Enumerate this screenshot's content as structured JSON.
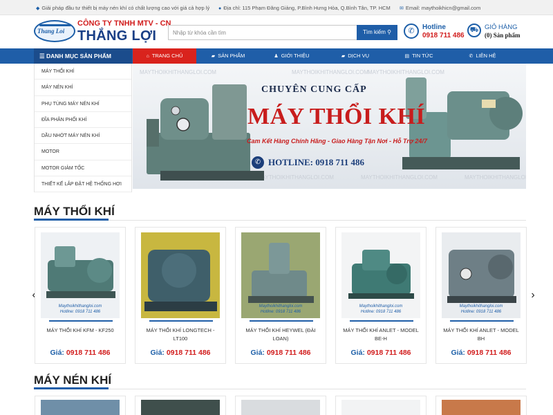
{
  "topbar": {
    "slogan": "Giải pháp đầu tư thiết bị máy nén khí có chất lượng cao với giá cả hợp lý",
    "address": "Địa chỉ: 115 Phạm Đăng Giảng, P.Bình Hưng Hòa, Q.Bình Tân, TP. HCM",
    "email": "Email: maythoikhicn@gmail.com"
  },
  "header": {
    "logo_text": "Thang Loi",
    "company_line1": "CÔNG TY TNHH MTV - CN",
    "company_line2": "THẮNG LỢI",
    "search_placeholder": "Nhập từ khóa cần tìm",
    "search_button": "Tìm kiếm",
    "hotline_label": "Hotline",
    "hotline_number": "0918 711 486",
    "cart_label": "GIỎ HÀNG",
    "cart_count": "(0) Sản phẩm"
  },
  "nav": {
    "category_title": "DANH MỤC SẢN PHẨM",
    "items": [
      "TRANG CHỦ",
      "SẢN PHẨM",
      "GIỚI THIỆU",
      "DỊCH VỤ",
      "TIN TỨC",
      "LIÊN HỆ"
    ]
  },
  "sidebar": {
    "items": [
      "MÁY THỔI KHÍ",
      "MÁY NÉN KHÍ",
      "PHỤ TÙNG MÁY NÉN KHÍ",
      "ĐĨA PHÂN PHỐI KHÍ",
      "DẦU NHỚT MÁY NÉN KHÍ",
      "MOTOR",
      "MOTOR GIẢM TỐC",
      "THIẾT KẾ LẮP ĐẶT HỆ THỐNG HƠI"
    ]
  },
  "banner": {
    "watermark": "MAYTHOIKHITHANGLOI.COM",
    "supply": "CHUYÊN CUNG CẤP",
    "title": "MÁY THỔI KHÍ",
    "tagline": "Cam Kết Hàng Chính Hãng - Giao Hàng Tận Nơi - Hỗ Trợ 24/7",
    "hotline": "HOTLINE: 0918 711 486"
  },
  "section1": {
    "title": "MÁY THỔI KHÍ",
    "products": [
      {
        "name": "MÁY THỔI KHÍ KFM - KF250",
        "price_label": "Giá:",
        "price": "0918 711 486",
        "image_caption": "Maythoikhithangloi.com",
        "image_phone": "Hotline: 0918 711 486"
      },
      {
        "name": "MÁY THỔI KHÍ LONGTECH - LT100",
        "price_label": "Giá:",
        "price": "0918 711 486",
        "image_caption": "",
        "image_phone": ""
      },
      {
        "name": "MÁY THỔI KHÍ HEYWEL (ĐÀI LOAN)",
        "price_label": "Giá:",
        "price": "0918 711 486",
        "image_caption": "Maythoikhithangloi.com",
        "image_phone": "Hotline: 0918 711 486"
      },
      {
        "name": "MÁY THỔI KHÍ ANLET - MODEL BE-H",
        "price_label": "Giá:",
        "price": "0918 711 486",
        "image_caption": "Maythoikhithangloi.com",
        "image_phone": "Hotline: 0918 711 486"
      },
      {
        "name": "MÁY THỔI KHÍ ANLET - MODEL BH",
        "price_label": "Giá:",
        "price": "0918 711 486",
        "image_caption": "Maythoikhithangloi.com",
        "image_phone": "Hotline: 0918 711 486"
      }
    ]
  },
  "section2": {
    "title": "MÁY NÉN KHÍ"
  },
  "icons": {
    "prev": "‹",
    "next": "›"
  },
  "colors": {
    "primary": "#1f5ea8",
    "accent": "#d11c1c",
    "nav_active": "#d9231d"
  }
}
